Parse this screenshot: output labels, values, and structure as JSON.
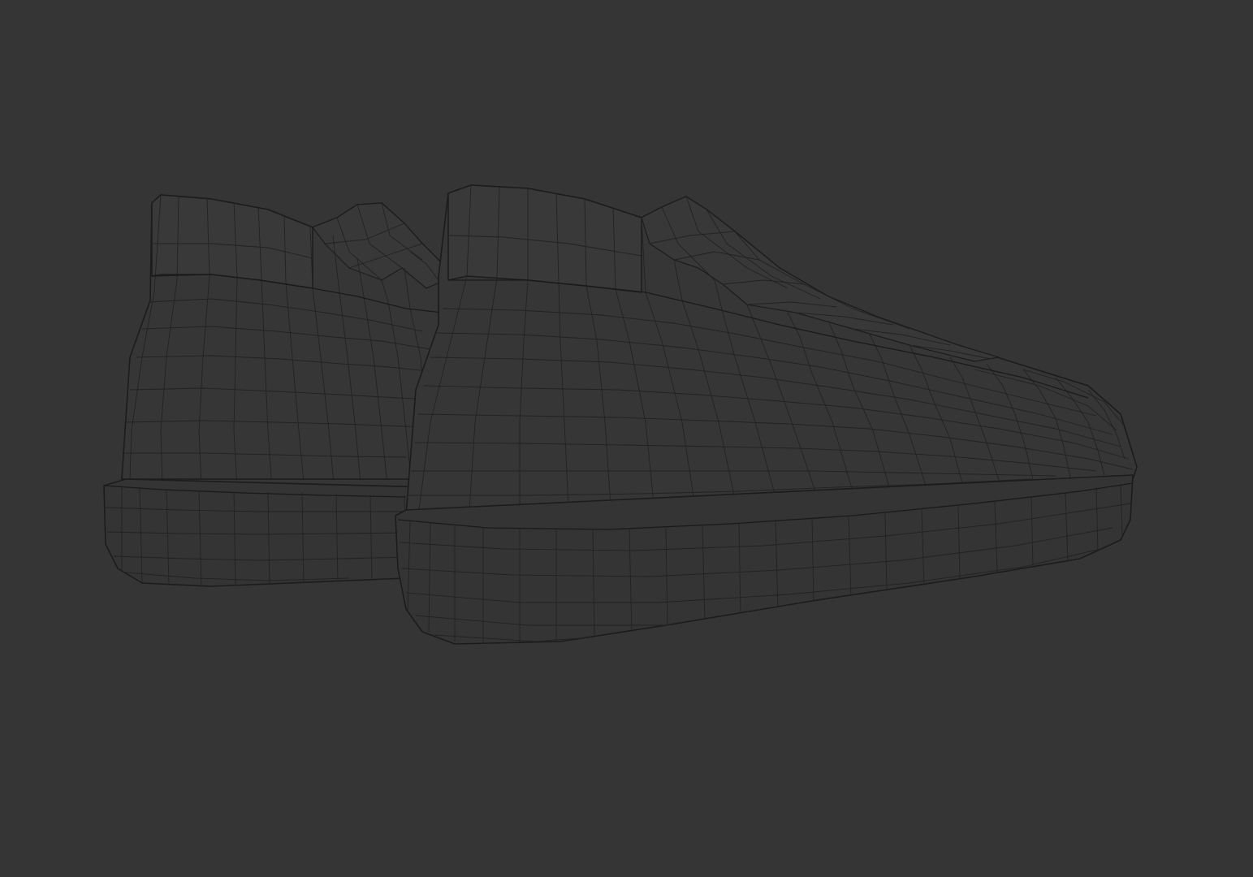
{
  "scene": {
    "background_color": "#353535",
    "mesh_fill": "#363636",
    "wire_color": "#222222",
    "render_mode": "wireframe",
    "objects": [
      "left-sneaker",
      "right-sneaker"
    ]
  }
}
